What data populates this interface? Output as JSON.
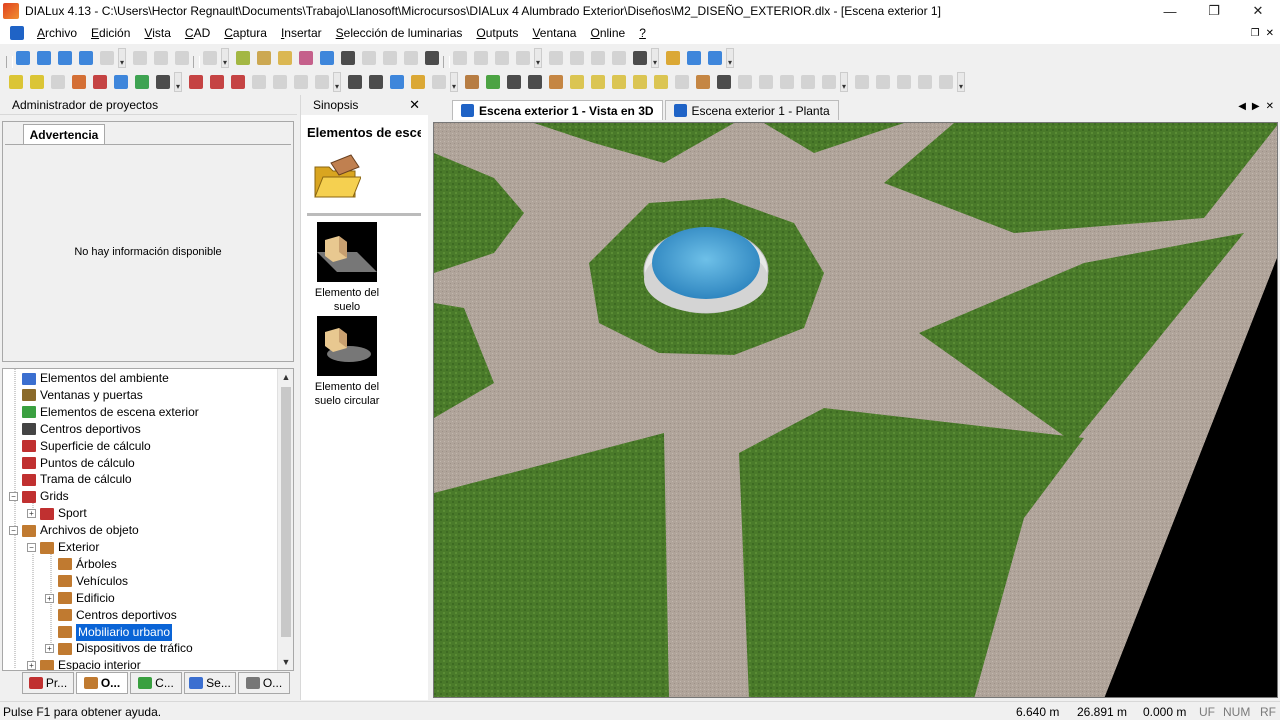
{
  "window": {
    "title": "DIALux 4.13 - C:\\Users\\Hector Regnault\\Documents\\Trabajo\\Llanosoft\\Microcursos\\DIALux 4 Alumbrado Exterior\\Diseños\\M2_DISEÑO_EXTERIOR.dlx - [Escena exterior 1]",
    "minimize": "—",
    "restore": "❐",
    "close": "✕"
  },
  "menu": {
    "items": [
      {
        "first": "A",
        "rest": "rchivo"
      },
      {
        "first": "E",
        "rest": "dición"
      },
      {
        "first": "V",
        "rest": "ista"
      },
      {
        "first": "C",
        "rest": "AD"
      },
      {
        "first": "C",
        "rest": "aptura"
      },
      {
        "first": "I",
        "rest": "nsertar"
      },
      {
        "first": "S",
        "rest": "elección de luminarias"
      },
      {
        "first": "O",
        "rest": "utputs"
      },
      {
        "first": "V",
        "rest": "entana"
      },
      {
        "first": "O",
        "rest": "nline"
      },
      {
        "first": "?",
        "rest": ""
      }
    ],
    "mdi_restore": "❐",
    "mdi_close": "✕"
  },
  "project_manager": {
    "header": "Administrador de proyectos",
    "warning_tab": "Advertencia",
    "no_info": "No hay información disponible"
  },
  "tree": {
    "items": [
      {
        "label": "Elementos del ambiente",
        "level": 1,
        "expander": "",
        "icon": "#3b6fd0",
        "selected": false
      },
      {
        "label": "Ventanas y puertas",
        "level": 1,
        "expander": "",
        "icon": "#8a6a2a",
        "selected": false
      },
      {
        "label": "Elementos de escena exterior",
        "level": 1,
        "expander": "",
        "icon": "#3aa040",
        "selected": false
      },
      {
        "label": "Centros deportivos",
        "level": 1,
        "expander": "",
        "icon": "#444444",
        "selected": false
      },
      {
        "label": "Superficie de cálculo",
        "level": 1,
        "expander": "",
        "icon": "#c03030",
        "selected": false
      },
      {
        "label": "Puntos de cálculo",
        "level": 1,
        "expander": "",
        "icon": "#c03030",
        "selected": false
      },
      {
        "label": "Trama de cálculo",
        "level": 1,
        "expander": "",
        "icon": "#c03030",
        "selected": false
      },
      {
        "label": "Grids",
        "level": 1,
        "expander": "-",
        "icon": "#c03030",
        "selected": false
      },
      {
        "label": "Sport",
        "level": 2,
        "expander": "+",
        "icon": "#c03030",
        "selected": false
      },
      {
        "label": "Archivos de objeto",
        "level": 1,
        "expander": "-",
        "icon": "#c07a30",
        "selected": false
      },
      {
        "label": "Exterior",
        "level": 2,
        "expander": "-",
        "icon": "#c07a30",
        "selected": false
      },
      {
        "label": "Árboles",
        "level": 3,
        "expander": "",
        "icon": "#c07a30",
        "selected": false
      },
      {
        "label": "Vehículos",
        "level": 3,
        "expander": "",
        "icon": "#c07a30",
        "selected": false
      },
      {
        "label": "Edificio",
        "level": 3,
        "expander": "+",
        "icon": "#c07a30",
        "selected": false
      },
      {
        "label": "Centros deportivos",
        "level": 3,
        "expander": "",
        "icon": "#c07a30",
        "selected": false
      },
      {
        "label": "Mobiliario urbano",
        "level": 3,
        "expander": "",
        "icon": "#c07a30",
        "selected": true
      },
      {
        "label": "Dispositivos de tráfico",
        "level": 3,
        "expander": "+",
        "icon": "#c07a30",
        "selected": false
      },
      {
        "label": "Espacio interior",
        "level": 2,
        "expander": "+",
        "icon": "#c07a30",
        "selected": false
      }
    ],
    "scroll_up": "▲",
    "scroll_down": "▼"
  },
  "bottom_tabs": [
    {
      "label": "Pr...",
      "icon": "#c03030",
      "active": false
    },
    {
      "label": "O...",
      "icon": "#c07a30",
      "active": true
    },
    {
      "label": "C...",
      "icon": "#3aa040",
      "active": false
    },
    {
      "label": "Se...",
      "icon": "#3b6fd0",
      "active": false
    },
    {
      "label": "O...",
      "icon": "#777777",
      "active": false
    }
  ],
  "synopsis": {
    "header": "Sinopsis",
    "close": "✕",
    "title": "Elementos de escena exterior",
    "items": [
      {
        "caption_line1": "Elemento del",
        "caption_line2": "suelo"
      },
      {
        "caption_line1": "Elemento del",
        "caption_line2": "suelo circular"
      }
    ]
  },
  "view_tabs": [
    {
      "label": "Escena exterior 1 - Vista en 3D",
      "icon": "#1f63c6",
      "active": true
    },
    {
      "label": "Escena exterior 1 - Planta",
      "icon": "#1f63c6",
      "active": false
    }
  ],
  "tab_nav": {
    "prev": "◀",
    "next": "▶",
    "close": "✕"
  },
  "status": {
    "help": "Pulse F1 para obtener ayuda.",
    "x": "6.640 m",
    "y": "26.891 m",
    "z": "0.000 m",
    "uf": "UF",
    "num": "NUM",
    "rf": "RF"
  },
  "colors": {
    "grass": "#4a7a2a",
    "path": "#b0a49a",
    "water": "#4aa0d0",
    "accent": "#0a64d6"
  }
}
